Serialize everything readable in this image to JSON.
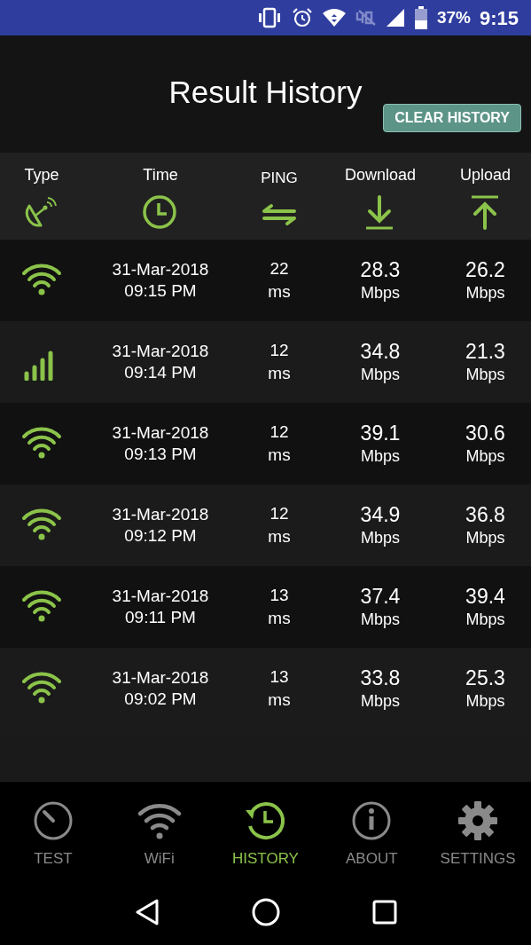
{
  "status_bar": {
    "battery": "37%",
    "time": "9:15"
  },
  "title": "Result History",
  "clear_button": "CLEAR HISTORY",
  "columns": [
    {
      "label": "Type",
      "kind": "dish"
    },
    {
      "label": "Time",
      "kind": "clock"
    },
    {
      "label": "PING",
      "kind": "swap"
    },
    {
      "label": "Download",
      "kind": "down"
    },
    {
      "label": "Upload",
      "kind": "up"
    }
  ],
  "rows": [
    {
      "kind": "wifi",
      "date": "31-Mar-2018",
      "time": "09:15 PM",
      "ping": "22",
      "ping_unit": "ms",
      "download": "28.3",
      "download_unit": "Mbps",
      "upload": "26.2",
      "upload_unit": "Mbps"
    },
    {
      "kind": "cellular",
      "date": "31-Mar-2018",
      "time": "09:14 PM",
      "ping": "12",
      "ping_unit": "ms",
      "download": "34.8",
      "download_unit": "Mbps",
      "upload": "21.3",
      "upload_unit": "Mbps"
    },
    {
      "kind": "wifi",
      "date": "31-Mar-2018",
      "time": "09:13 PM",
      "ping": "12",
      "ping_unit": "ms",
      "download": "39.1",
      "download_unit": "Mbps",
      "upload": "30.6",
      "upload_unit": "Mbps"
    },
    {
      "kind": "wifi",
      "date": "31-Mar-2018",
      "time": "09:12 PM",
      "ping": "12",
      "ping_unit": "ms",
      "download": "34.9",
      "download_unit": "Mbps",
      "upload": "36.8",
      "upload_unit": "Mbps"
    },
    {
      "kind": "wifi",
      "date": "31-Mar-2018",
      "time": "09:11 PM",
      "ping": "13",
      "ping_unit": "ms",
      "download": "37.4",
      "download_unit": "Mbps",
      "upload": "39.4",
      "upload_unit": "Mbps"
    },
    {
      "kind": "wifi",
      "date": "31-Mar-2018",
      "time": "09:02 PM",
      "ping": "13",
      "ping_unit": "ms",
      "download": "33.8",
      "download_unit": "Mbps",
      "upload": "25.3",
      "upload_unit": "Mbps"
    }
  ],
  "nav": [
    {
      "label": "TEST",
      "kind": "gauge",
      "selected": false
    },
    {
      "label": "WiFi",
      "kind": "wifi",
      "selected": false
    },
    {
      "label": "HISTORY",
      "kind": "history",
      "selected": true
    },
    {
      "label": "ABOUT",
      "kind": "info",
      "selected": false
    },
    {
      "label": "SETTINGS",
      "kind": "gear",
      "selected": false
    }
  ]
}
